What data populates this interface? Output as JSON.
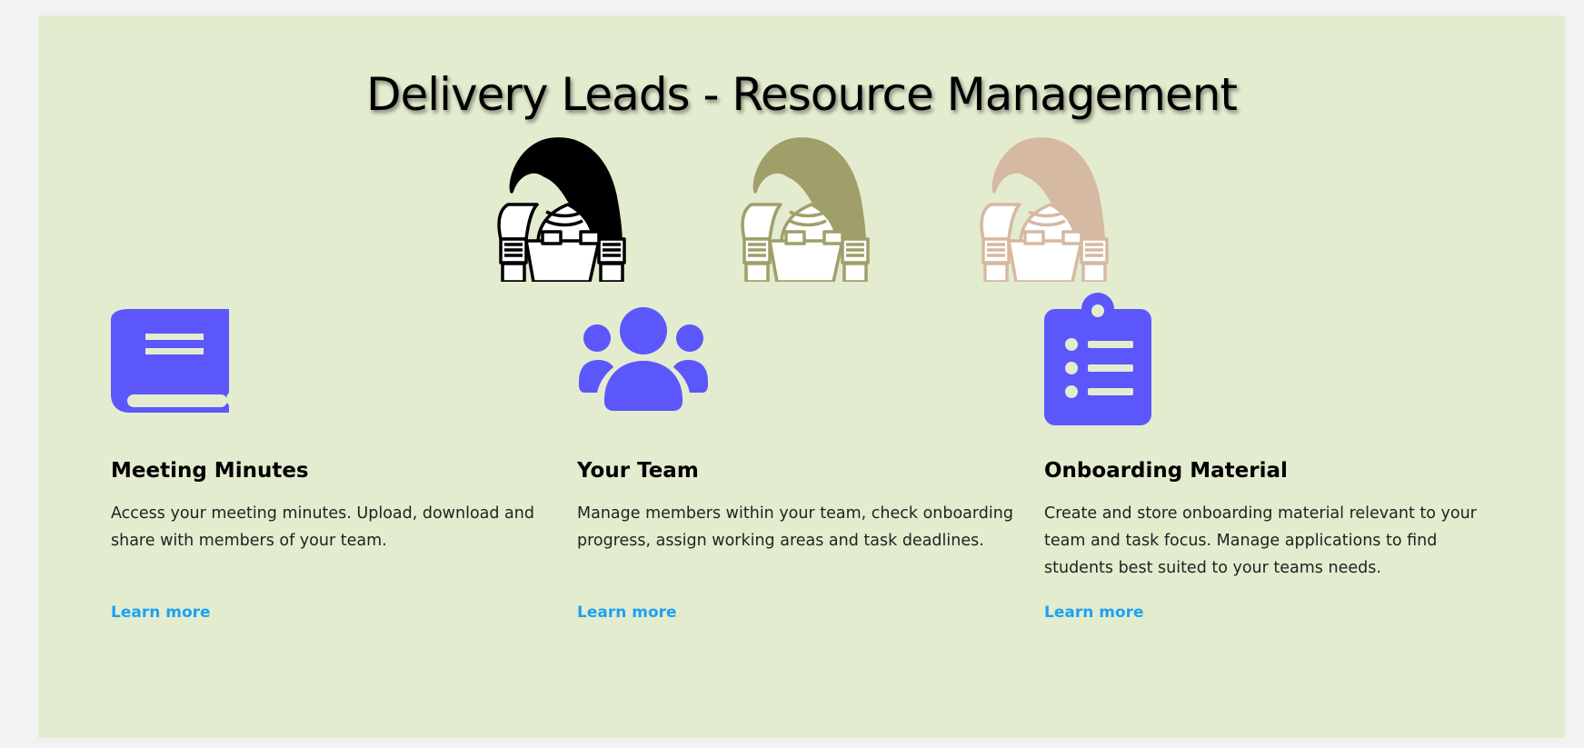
{
  "header": {
    "title": "Delivery Leads - Resource Management"
  },
  "mascots": [
    {
      "icon": "thoth-ibis-icon",
      "color": "#000000"
    },
    {
      "icon": "thoth-ibis-icon",
      "color": "#a09f6a"
    },
    {
      "icon": "thoth-ibis-icon",
      "color": "#d6b9a2"
    }
  ],
  "cards": [
    {
      "icon": "book-icon",
      "title": "Meeting Minutes",
      "description": "Access your meeting minutes. Upload, download and share with members of your team.",
      "link": "Learn more"
    },
    {
      "icon": "team-icon",
      "title": "Your Team",
      "description": "Manage members within your team, check onboarding progress, assign working areas and task deadlines.",
      "link": "Learn more"
    },
    {
      "icon": "clipboard-list-icon",
      "title": "Onboarding Material",
      "description": "Create and store onboarding material relevant to your team and task focus. Manage applications to find students best suited to your teams needs.",
      "link": "Learn more"
    }
  ],
  "colors": {
    "background": "#e3ecce",
    "accent_icon": "#5b57fb",
    "link": "#1da1f2"
  }
}
